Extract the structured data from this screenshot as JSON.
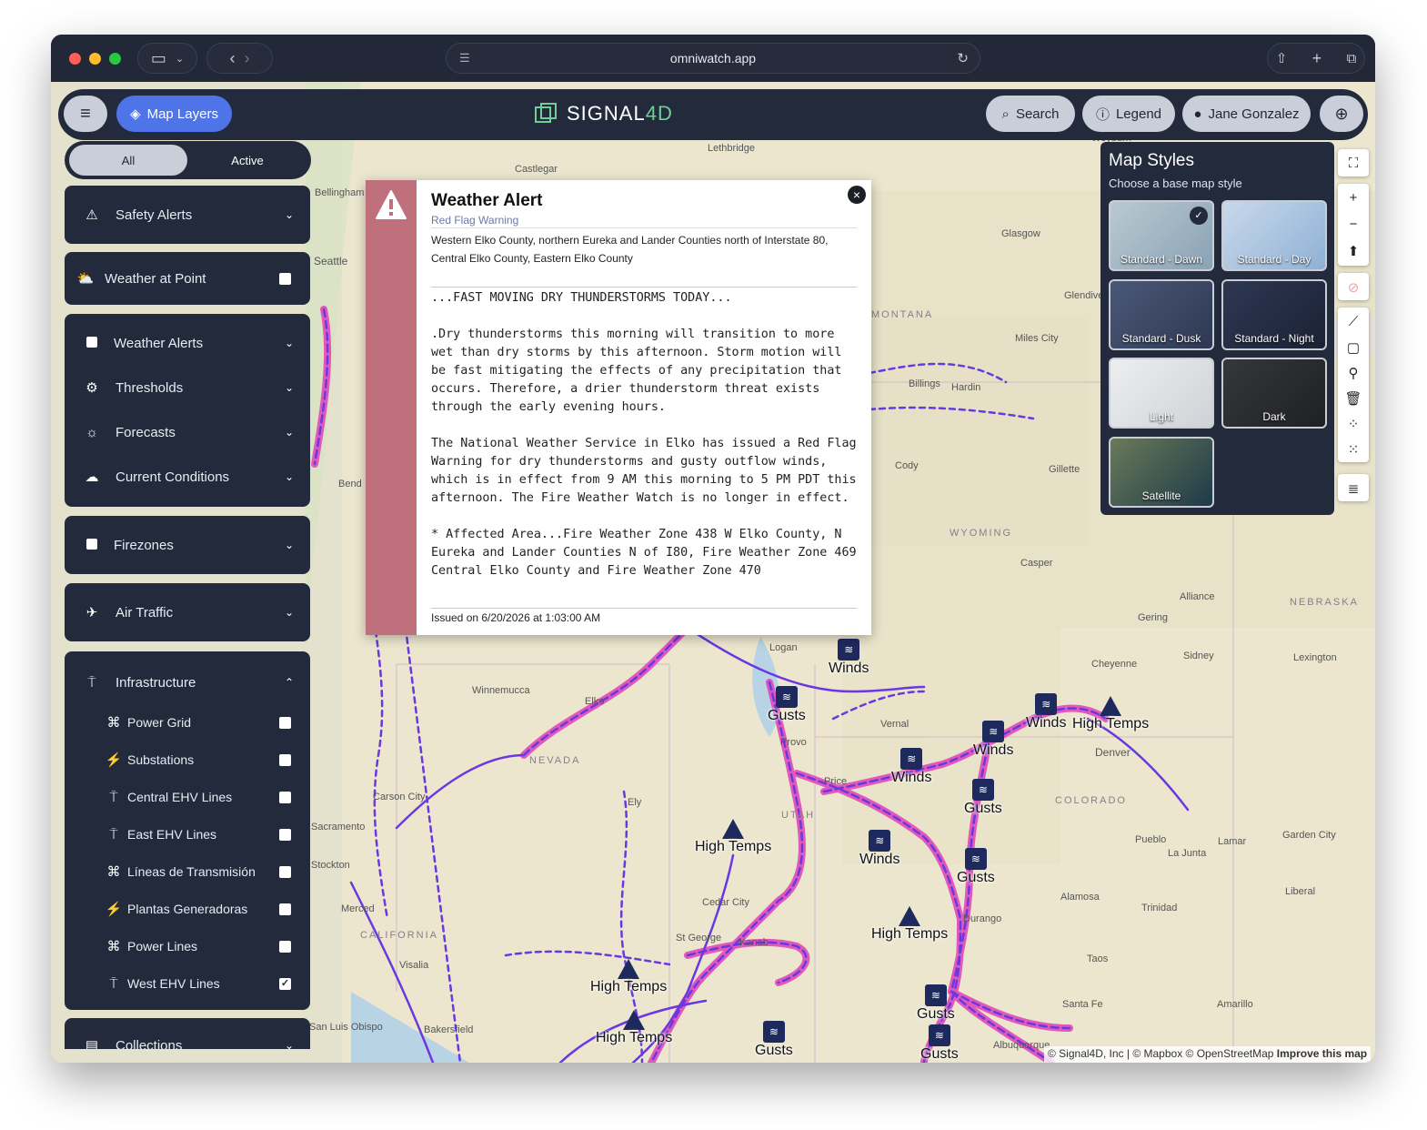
{
  "browser": {
    "url": "omniwatch.app"
  },
  "appbar": {
    "map_layers": "Map Layers",
    "logo_main": "SIGNAL",
    "logo_accent": "4D",
    "search": "Search",
    "legend": "Legend",
    "user": "Jane Gonzalez"
  },
  "sidebar": {
    "seg_all": "All",
    "seg_active": "Active",
    "safety_alerts": "Safety Alerts",
    "weather_at_point": "Weather at Point",
    "weather_alerts": "Weather Alerts",
    "thresholds": "Thresholds",
    "forecasts": "Forecasts",
    "current_conditions": "Current Conditions",
    "firezones": "Firezones",
    "air_traffic": "Air Traffic",
    "infrastructure": "Infrastructure",
    "infra_items": [
      {
        "label": "Power Grid",
        "checked": false
      },
      {
        "label": "Substations",
        "checked": false
      },
      {
        "label": "Central EHV Lines",
        "checked": false
      },
      {
        "label": "East EHV Lines",
        "checked": false
      },
      {
        "label": "Líneas de Transmisión",
        "checked": false
      },
      {
        "label": "Plantas Generadoras",
        "checked": false
      },
      {
        "label": "Power Lines",
        "checked": false
      },
      {
        "label": "West EHV Lines",
        "checked": true
      }
    ],
    "collections": "Collections"
  },
  "alert": {
    "title": "Weather Alert",
    "subtitle": "Red Flag Warning",
    "area": "Western Elko County, northern Eureka and Lander Counties north of Interstate 80, Central Elko County, Eastern Elko County",
    "body": "...FAST MOVING DRY THUNDERSTORMS TODAY...\n\n.Dry thunderstorms this morning will transition to more wet than dry storms by this afternoon. Storm motion will be fast mitigating the effects of any precipitation that occurs. Therefore, a drier thunderstorm threat exists through the early evening hours.\n\nThe National Weather Service in Elko has issued a Red Flag Warning for dry thunderstorms and gusty outflow winds, which is in effect from 9 AM this morning to 5 PM PDT this afternoon. The Fire Weather Watch is no longer in effect.\n\n* Affected Area...Fire Weather Zone 438 W Elko County, N Eureka and Lander Counties N of I80, Fire Weather Zone 469 Central Elko County and Fire Weather Zone 470",
    "issued": "Issued on 6/20/2026 at 1:03:00 AM"
  },
  "map_styles": {
    "title": "Map Styles",
    "subtitle": "Choose a base map style",
    "options": [
      {
        "label": "Standard - Dawn",
        "selected": true,
        "color": "#9fb6c6"
      },
      {
        "label": "Standard - Day",
        "selected": false,
        "color": "#a9c3dc"
      },
      {
        "label": "Standard - Dusk",
        "selected": false,
        "color": "#3d4a66"
      },
      {
        "label": "Standard - Night",
        "selected": false,
        "color": "#252d44"
      },
      {
        "label": "Light",
        "selected": false,
        "color": "#dfe1e4"
      },
      {
        "label": "Dark",
        "selected": false,
        "color": "#2b2d30"
      },
      {
        "label": "Satellite",
        "selected": false,
        "color": "#4a5a48"
      }
    ]
  },
  "map_labels": {
    "cities": [
      "Lethbridge",
      "Castlegar",
      "Bellingham",
      "Seattle",
      "Weyburn",
      "Glasgow",
      "Glendive",
      "Miles City",
      "Billings",
      "Hardin",
      "Cody",
      "Gillette",
      "Casper",
      "Alliance",
      "Gering",
      "Sidney",
      "Cheyenne",
      "Lexington",
      "Bend",
      "Winnemucca",
      "Elko",
      "Logan",
      "Vernal",
      "Provo",
      "Price",
      "Denver",
      "Carson City",
      "Ely",
      "Cedar City",
      "St George",
      "Kanab",
      "Pueblo",
      "La Junta",
      "Lamar",
      "Garden City",
      "Liberal",
      "Alamosa",
      "Trinidad",
      "Durango",
      "Taos",
      "Santa Fe",
      "Amarillo",
      "Albuquerque",
      "Merced",
      "Visalia",
      "Bakersfield",
      "San Luis Obispo",
      "Stockton",
      "Sacramento"
    ],
    "states": [
      "MONTANA",
      "WYOMING",
      "NEBRASKA",
      "NEVADA",
      "UTAH",
      "COLORADO",
      "CALIFORNIA"
    ]
  },
  "markers": [
    {
      "type": "wind",
      "label": "Winds"
    },
    {
      "type": "wind",
      "label": "Gusts"
    },
    {
      "type": "wind",
      "label": "Winds"
    },
    {
      "type": "warn",
      "label": "High Temps"
    },
    {
      "type": "wind",
      "label": "Winds"
    },
    {
      "type": "wind",
      "label": "Winds"
    },
    {
      "type": "wind",
      "label": "Gusts"
    },
    {
      "type": "warn",
      "label": "High Temps"
    },
    {
      "type": "wind",
      "label": "Winds"
    },
    {
      "type": "wind",
      "label": "Gusts"
    },
    {
      "type": "warn",
      "label": "High Temps"
    },
    {
      "type": "warn",
      "label": "High Temps"
    },
    {
      "type": "warn",
      "label": "High Temps"
    },
    {
      "type": "wind",
      "label": "Gusts"
    },
    {
      "type": "wind",
      "label": "Gusts"
    },
    {
      "type": "wind",
      "label": "Gusts"
    }
  ],
  "attribution": {
    "text": "© Signal4D, Inc | © Mapbox © OpenStreetMap",
    "improve": "Improve this map"
  },
  "colors": {
    "accent": "#4e74e8",
    "panel": "#232a3b",
    "alert_stripe": "#c06f7d",
    "line_purple": "#6a38e0",
    "line_pink": "#e040b8"
  }
}
